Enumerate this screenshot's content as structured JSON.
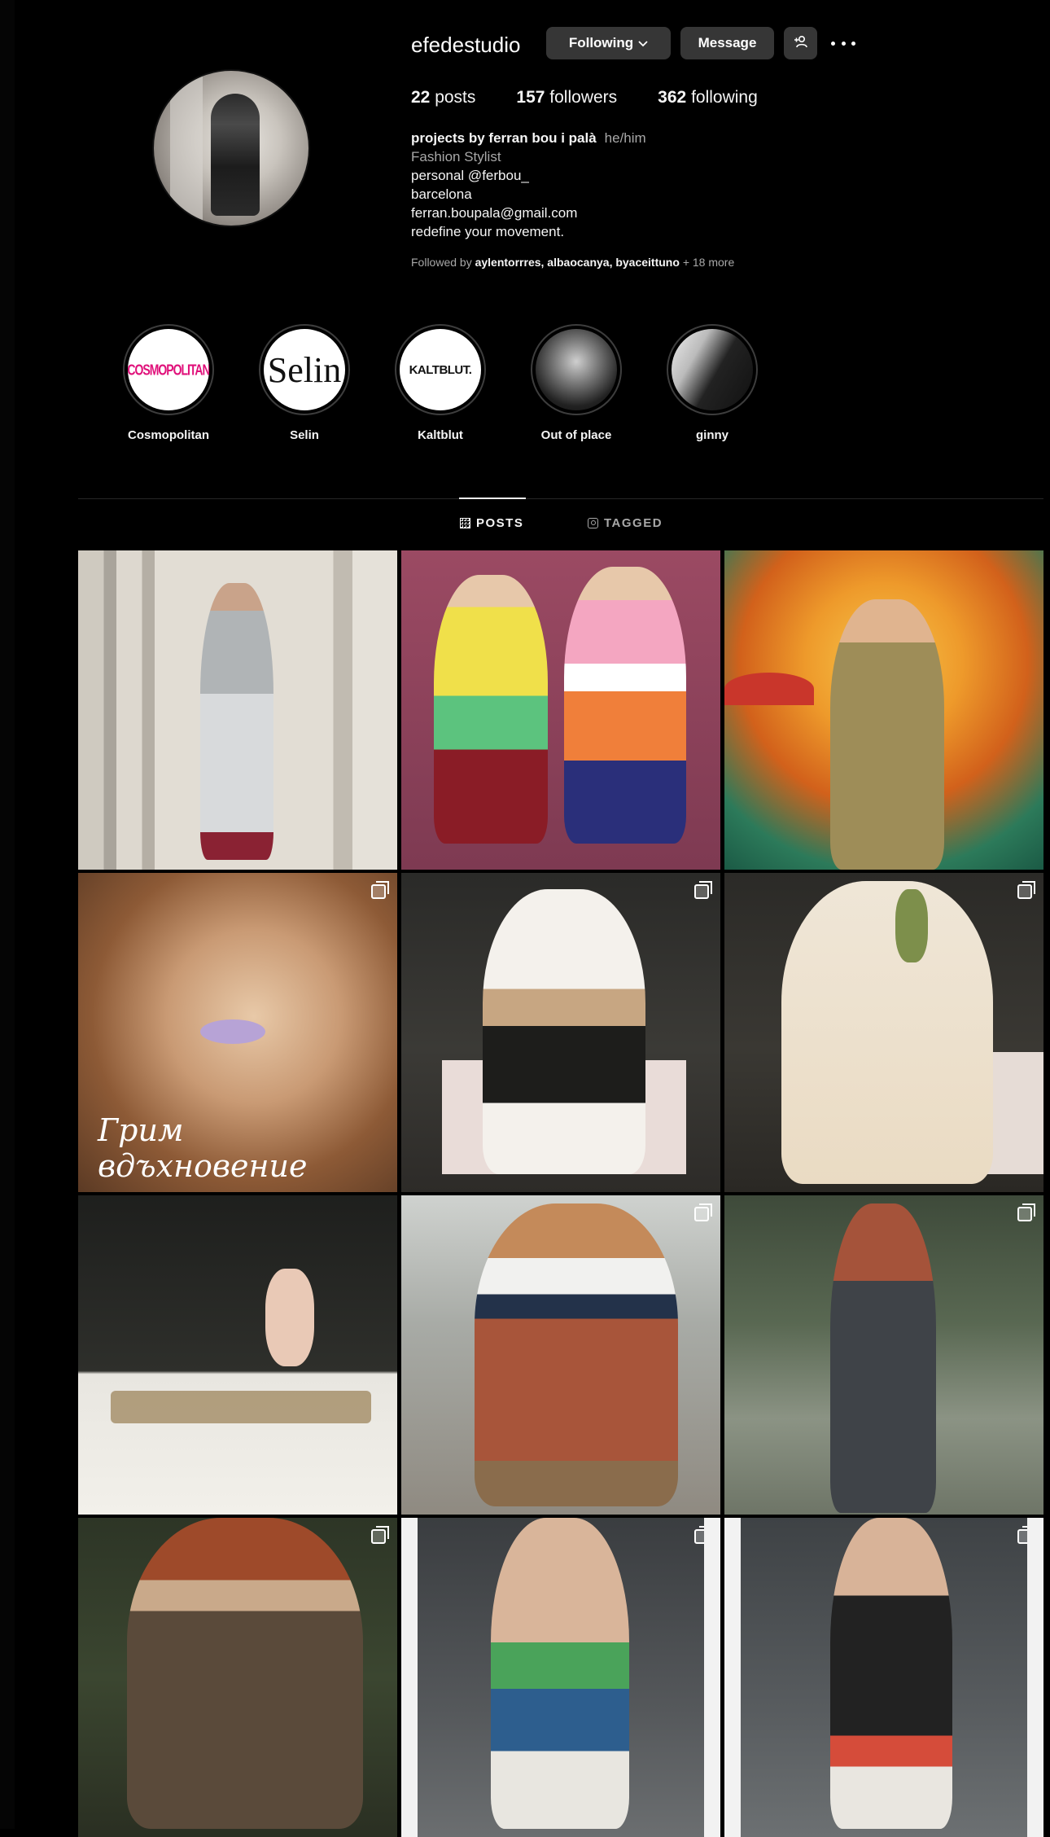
{
  "profile": {
    "username": "efedestudio",
    "following_label": "Following",
    "message_label": "Message",
    "stats": {
      "posts_count": "22",
      "posts_label": "posts",
      "followers_count": "157",
      "followers_label": "followers",
      "following_count": "362",
      "following_label": "following"
    },
    "bio": {
      "name": "projects by ferran bou i palà",
      "pronouns": "he/him",
      "category": "Fashion Stylist",
      "lines": [
        "personal @ferbou_",
        "barcelona",
        "ferran.boupala@gmail.com",
        "redefine your movement."
      ]
    },
    "followed_by": {
      "prefix": "Followed by",
      "names": "aylentorrres, albaocanya, byaceittuno",
      "suffix": "+ 18 more"
    }
  },
  "highlights": [
    {
      "label": "Cosmopolitan",
      "logo": "COSMOPOLITAN"
    },
    {
      "label": "Selin",
      "logo": "Selin"
    },
    {
      "label": "Kaltblut",
      "logo": "KALTBLUT."
    },
    {
      "label": "Out of place",
      "logo": ""
    },
    {
      "label": "ginny",
      "logo": ""
    }
  ],
  "tabs": {
    "posts": "POSTS",
    "tagged": "TAGGED"
  },
  "posts": {
    "caption_4": "Грим вдъхновение"
  },
  "icons": {
    "more": "more-options-icon",
    "add_user": "add-user-icon",
    "chevron": "chevron-down-icon",
    "grid": "grid-icon",
    "tagged": "tagged-icon",
    "multi": "carousel-icon"
  }
}
